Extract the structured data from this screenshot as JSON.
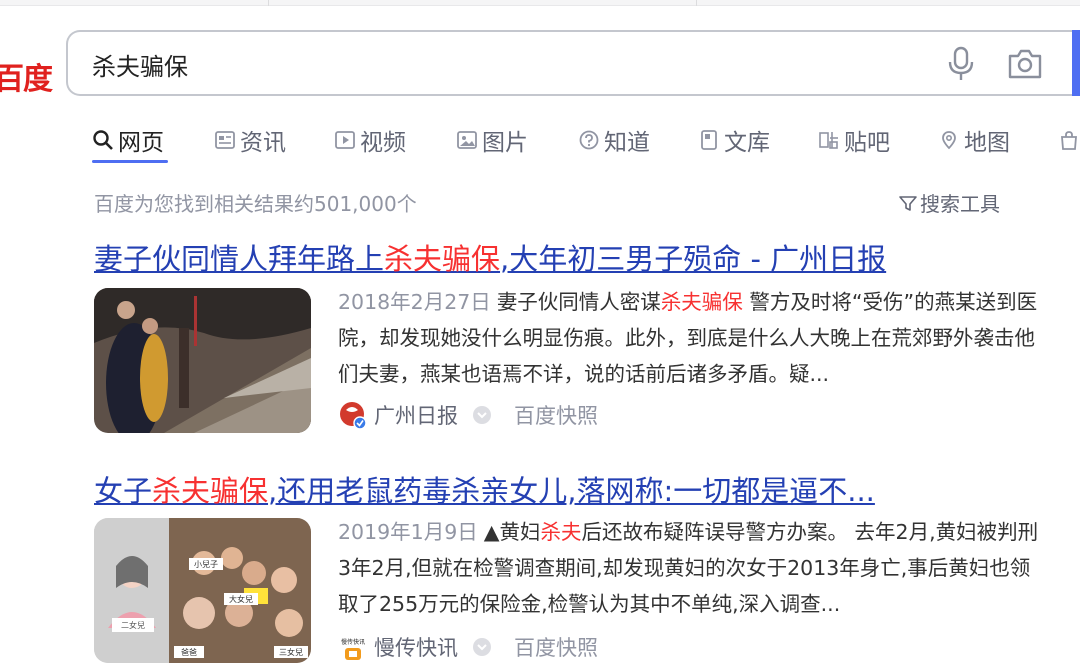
{
  "logo": {
    "text": "百度"
  },
  "search": {
    "query": "杀夫骗保"
  },
  "tabs": [
    {
      "label": "网页",
      "icon": "search-icon",
      "active": true
    },
    {
      "label": "资讯",
      "icon": "news-icon"
    },
    {
      "label": "视频",
      "icon": "video-icon"
    },
    {
      "label": "图片",
      "icon": "image-icon"
    },
    {
      "label": "知道",
      "icon": "question-icon"
    },
    {
      "label": "文库",
      "icon": "document-icon"
    },
    {
      "label": "贴吧",
      "icon": "tieba-icon"
    },
    {
      "label": "地图",
      "icon": "map-icon"
    }
  ],
  "results_info": {
    "count_text": "百度为您找到相关结果约501,000个",
    "tools_label": "搜索工具"
  },
  "results": [
    {
      "title_pre": "妻子伙同情人拜年路上",
      "title_hl": "杀夫骗保",
      "title_post": ",大年初三男子殒命 - 广州日报",
      "date": "2018年2月27日",
      "snippet_pre": "妻子伙同情人密谋",
      "snippet_hl": "杀夫骗保",
      "snippet_post": " 警方及时将“受伤”的燕某送到医院，却发现她没什么明显伤痕。此外，到底是什么人大晚上在荒郊野外袭击他们夫妻，燕某也语焉不详，说的话前后诸多矛盾。疑...",
      "source": "广州日报",
      "cache": "百度快照"
    },
    {
      "title_pre": "女子",
      "title_hl": "杀夫骗保",
      "title_post": ",还用老鼠药毒杀亲女儿,落网称:一切都是逼不...",
      "date": "2019年1月9日",
      "snippet_pre": "▲黄妇",
      "snippet_hl": "杀夫",
      "snippet_post": "后还故布疑阵误导警方办案。 去年2月,黄妇被判刑3年2月,但就在检警调查期间,却发现黄妇的次女于2013年身亡,事后黄妇也领取了255万元的保险金,检警认为其中不单纯,深入调查...",
      "source": "慢传快讯",
      "source_logo_text": "慢传快讯",
      "cache": "百度快照",
      "image_labels": [
        "小兒子",
        "二女兒",
        "大女兒",
        "爸爸",
        "三女兒"
      ]
    }
  ],
  "colors": {
    "brand_red": "#e0211e",
    "link_blue": "#2440b3",
    "highlight_red": "#f73131",
    "accent_blue": "#4e6ef2",
    "muted_gray": "#9195a3"
  }
}
